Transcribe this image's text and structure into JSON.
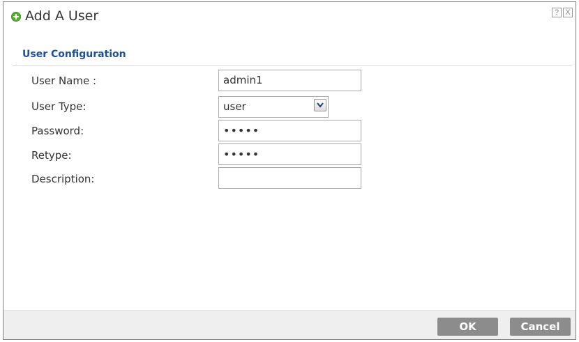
{
  "dialog": {
    "title": "Add A User",
    "help_glyph": "?",
    "close_glyph": "X",
    "icons": {
      "title": "add-circle-icon",
      "help": "help-icon",
      "close": "close-icon"
    }
  },
  "section": {
    "title": "User Configuration"
  },
  "fields": {
    "user_name": {
      "label": "User Name :",
      "value": "admin1"
    },
    "user_type": {
      "label": "User Type:",
      "value": "user"
    },
    "password": {
      "label": "Password:",
      "value": "•••••"
    },
    "retype": {
      "label": "Retype:",
      "value": "•••••"
    },
    "description": {
      "label": "Description:",
      "value": ""
    }
  },
  "buttons": {
    "ok": "OK",
    "cancel": "Cancel"
  },
  "colors": {
    "section_title": "#1e4f9c",
    "button_bg": "#8c8c8c",
    "footer_bg": "#efefef",
    "add_icon": "#59b02f"
  }
}
